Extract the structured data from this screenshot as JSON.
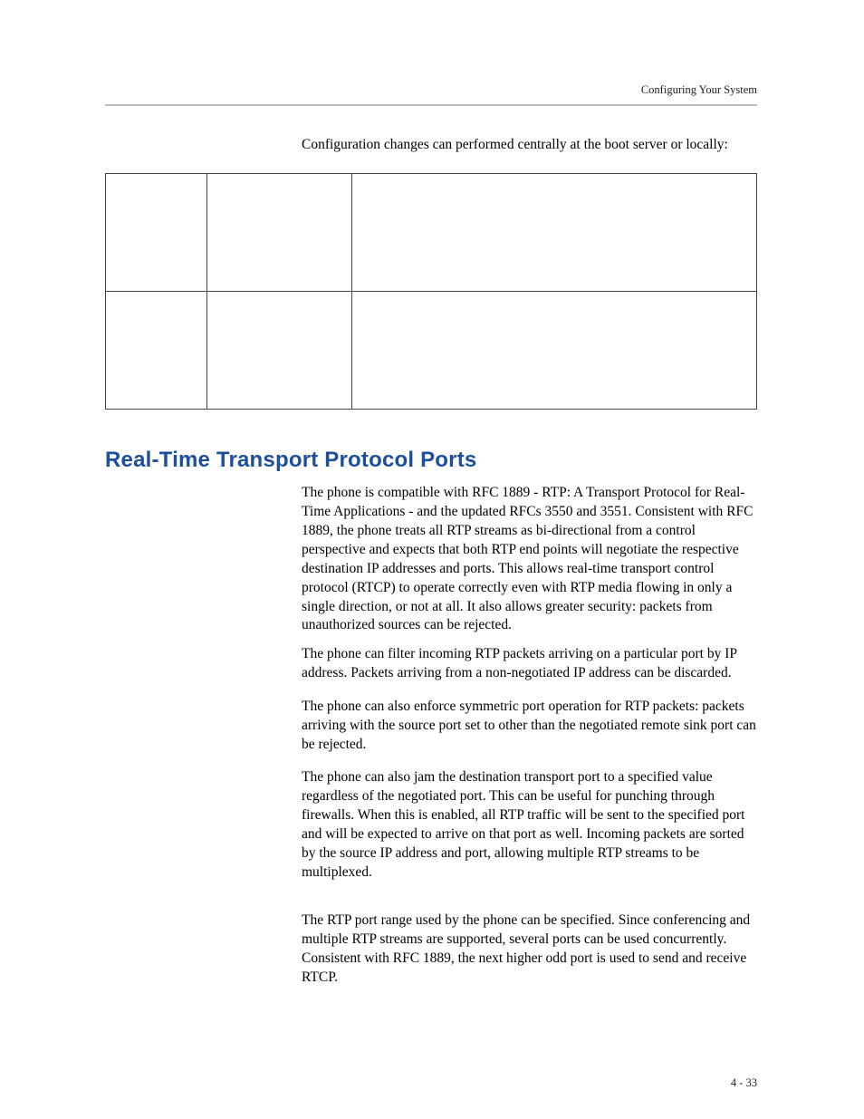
{
  "header": {
    "running_head": "Configuring Your System"
  },
  "intro": "Configuration changes can performed centrally at the boot server or locally:",
  "table": {
    "rows": [
      {
        "c0": "",
        "c1": "",
        "c2": ""
      },
      {
        "c0": "",
        "c1": "",
        "c2": ""
      }
    ]
  },
  "section": {
    "title": "Real-Time Transport Protocol Ports"
  },
  "paragraphs": {
    "p1": "The phone is compatible with RFC 1889 - RTP: A Transport Protocol for Real-Time Applications - and the updated RFCs 3550 and 3551. Consistent with RFC 1889, the phone treats all RTP streams as bi-directional from a control perspective and expects that both RTP end points will negotiate the respective destination IP addresses and ports. This allows real-time transport control protocol (RTCP) to operate correctly even with RTP media flowing in only a single direction, or not at all. It also allows greater security: packets from unauthorized sources can be rejected.",
    "p2": "The phone can filter incoming RTP packets arriving on a particular port by IP address. Packets arriving from a non-negotiated IP address can be discarded.",
    "p3": "The phone can also enforce symmetric port operation for RTP packets: packets arriving with the source port set to other than the negotiated remote sink port can be rejected.",
    "p4": "The phone can also jam the destination transport port to a specified value regardless of the negotiated port. This can be useful for punching through firewalls. When this is enabled, all RTP traffic will be sent to the specified port and will be expected to arrive on that port as well. Incoming packets are sorted by the source IP address and port, allowing multiple RTP streams to be multiplexed.",
    "p5": "The RTP port range used by the phone can be specified. Since conferencing and multiple RTP streams are supported, several ports can be used concurrently. Consistent with RFC 1889, the next higher odd port is used to send and receive RTCP."
  },
  "footer": {
    "page_label": "4 - 33"
  }
}
